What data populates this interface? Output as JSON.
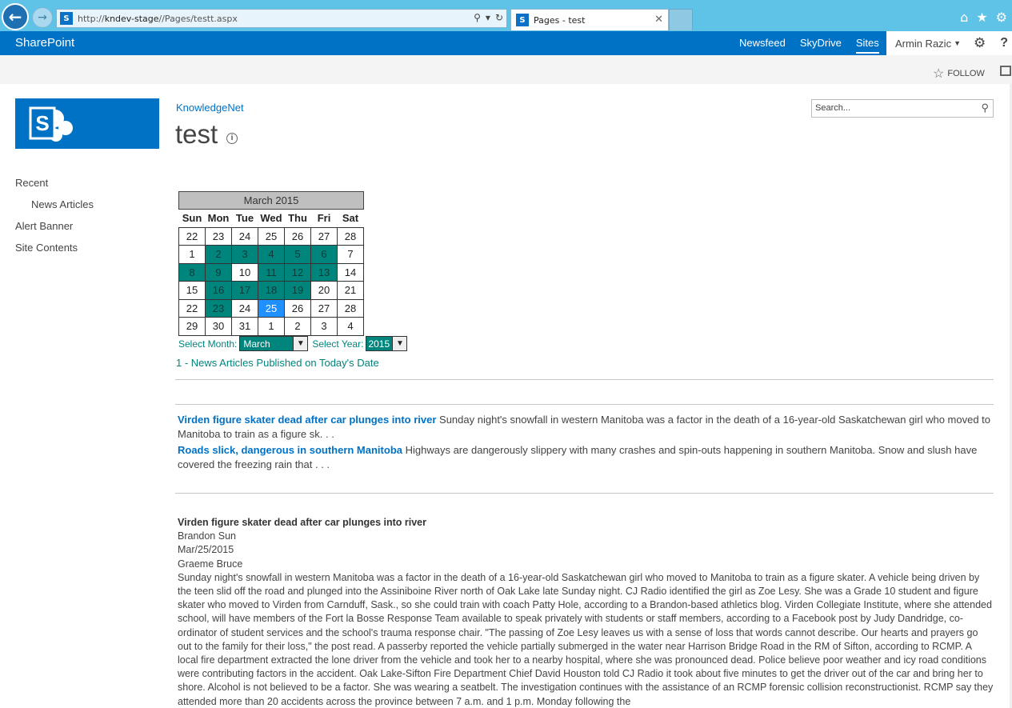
{
  "browser": {
    "url_prefix": "http://",
    "url_host": "kndev-stage",
    "url_path": "//Pages/testt.aspx",
    "tab_title": "Pages - test"
  },
  "suitebar": {
    "brand": "SharePoint",
    "links": [
      "Newsfeed",
      "SkyDrive",
      "Sites"
    ],
    "user": "Armin Razic"
  },
  "ribbon": {
    "follow": "FOLLOW"
  },
  "site": {
    "breadcrumb": "KnowledgeNet",
    "title": "test",
    "search_placeholder": "Search..."
  },
  "leftnav": {
    "items": [
      "Recent",
      "News Articles",
      "Alert Banner",
      "Site Contents"
    ]
  },
  "calendar": {
    "caption": "March 2015",
    "days": [
      "Sun",
      "Mon",
      "Tue",
      "Wed",
      "Thu",
      "Fri",
      "Sat"
    ],
    "weeks": [
      [
        "22",
        "23",
        "24",
        "25",
        "26",
        "27",
        "28"
      ],
      [
        "1",
        "2",
        "3",
        "4",
        "5",
        "6",
        "7"
      ],
      [
        "8",
        "9",
        "10",
        "11",
        "12",
        "13",
        "14"
      ],
      [
        "15",
        "16",
        "17",
        "18",
        "19",
        "20",
        "21"
      ],
      [
        "22",
        "23",
        "24",
        "25",
        "26",
        "27",
        "28"
      ],
      [
        "29",
        "30",
        "31",
        "1",
        "2",
        "3",
        "4"
      ]
    ],
    "highlight_color": "#00857c",
    "today_color": "#1e90ff",
    "select_month_label": "Select Month:",
    "select_month_value": "March",
    "select_year_label": "Select Year:",
    "select_year_value": "2015",
    "today_link": "1 - News Articles Published on Today's Date"
  },
  "news": [
    {
      "title": "Virden figure skater dead after car plunges into river",
      "snippet": " Sunday night's snowfall in western Manitoba was a factor in the death of a 16-year-old Saskatchewan girl who moved to Manitoba to train as a figure sk. . ."
    },
    {
      "title": "Roads slick, dangerous in southern Manitoba",
      "snippet": " Highways are dangerously slippery with many crashes and spin-outs happening in southern Manitoba. Snow and slush have covered the freezing rain that . . ."
    }
  ],
  "article": {
    "title": "Virden figure skater dead after car plunges into river",
    "source": "Brandon Sun",
    "date": "Mar/25/2015",
    "author": "Graeme Bruce",
    "body": "Sunday night's snowfall in western Manitoba was a factor in the death of a 16-year-old Saskatchewan girl who moved to Manitoba to train as a figure skater. A vehicle being driven by the teen slid off the road and plunged into the Assiniboine River north of Oak Lake late Sunday night. CJ Radio identified the girl as Zoe Lesy. She was a Grade 10 student and figure skater who moved to Virden from Carnduff, Sask., so she could train with coach Patty Hole, according to a Brandon-based athletics blog. Virden Collegiate Institute, where she attended school, will have members of the Fort la Bosse Response Team available to speak privately with students or staff members, according to a Facebook post by Judy Dandridge, co-ordinator of student services and the school's trauma response chair. \"The passing of Zoe Lesy leaves us with a sense of loss that words cannot describe. Our hearts and prayers go out to the family for their loss,\" the post read. A passerby reported the vehicle partially submerged in the water near Harrison Bridge Road in the RM of Sifton, according to RCMP. A local fire department extracted the lone driver from the vehicle and took her to a nearby hospital, where she was pronounced dead. Police believe poor weather and icy road conditions were contributing factors in the accident. Oak Lake-Sifton Fire Department Chief David Houston told CJ Radio it took about five minutes to get the driver out of the car and bring her to shore. Alcohol is not believed to be a factor. She was wearing a seatbelt. The investigation continues with the assistance of an RCMP forensic collision reconstructionist. RCMP say they attended more than 20 accidents across the province between 7 a.m. and 1 p.m. Monday following the"
  }
}
